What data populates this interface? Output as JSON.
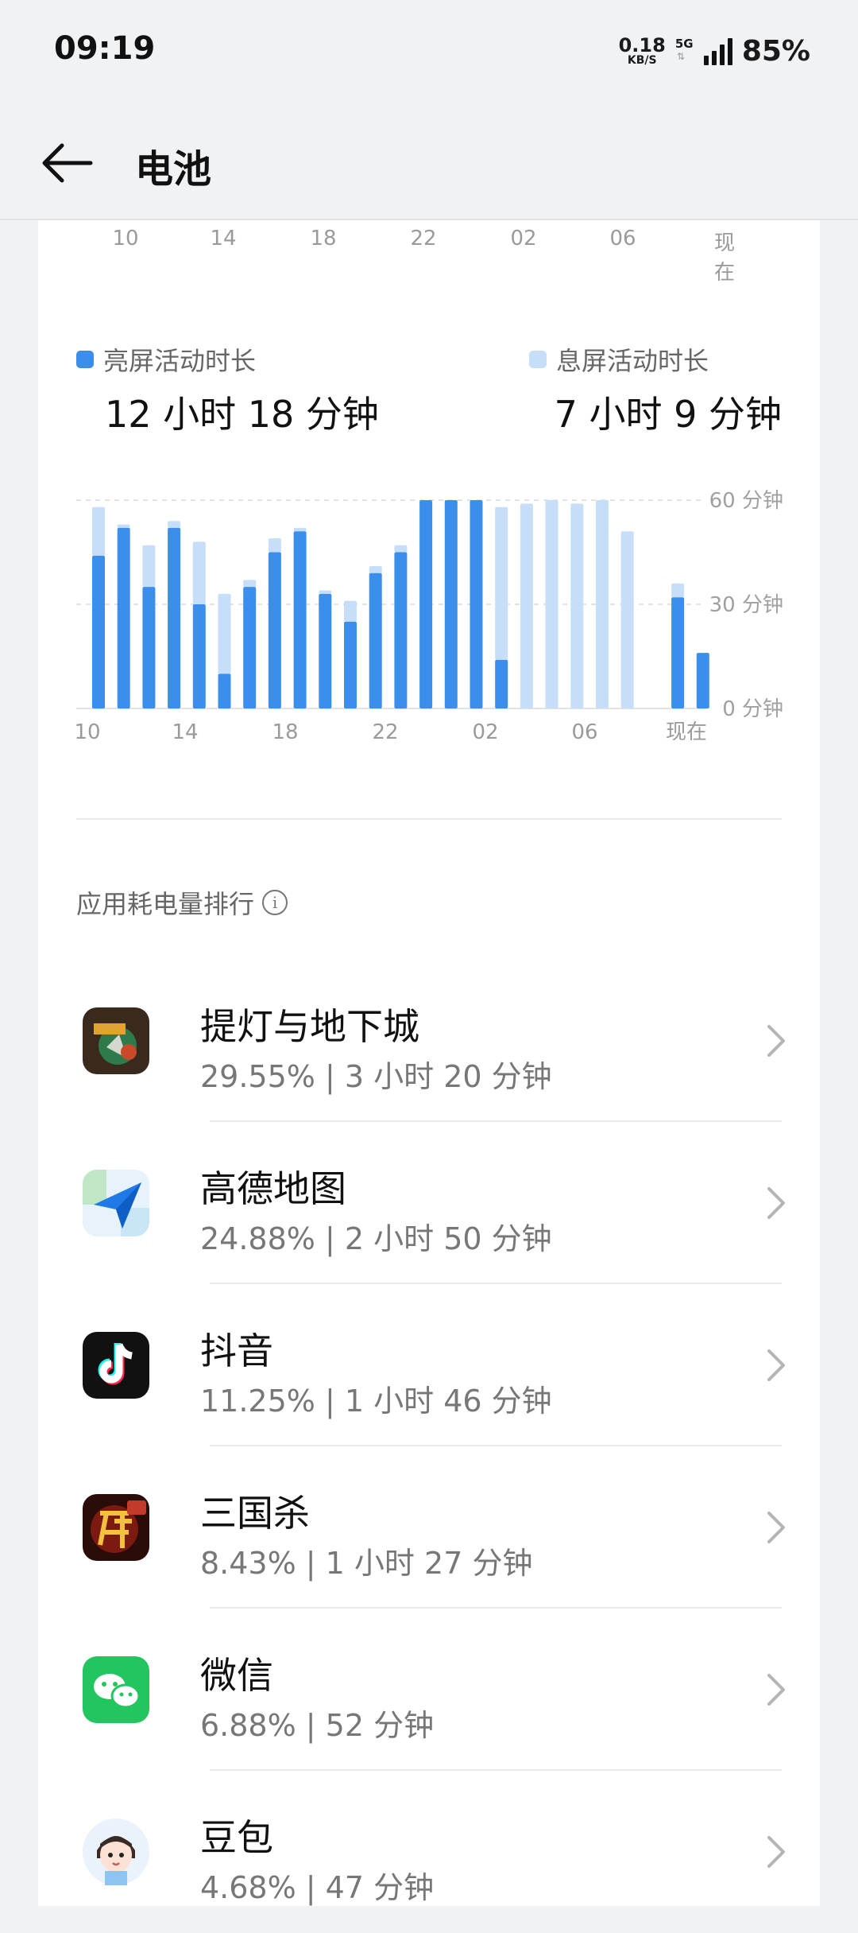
{
  "status_bar": {
    "time": "09:19",
    "net_speed_value": "0.18",
    "net_speed_unit": "KB/S",
    "network": "5G",
    "battery": "85%",
    "icons": [
      "signal-icon"
    ]
  },
  "header": {
    "title": "电池",
    "back_icon": "back-arrow-icon"
  },
  "time_axis": [
    "10",
    "14",
    "18",
    "22",
    "02",
    "06",
    "现在"
  ],
  "legend": {
    "screen_on_label": "亮屏活动时长",
    "screen_on_value": "12 小时 18 分钟",
    "screen_off_label": "息屏活动时长",
    "screen_off_value": "7 小时 9 分钟"
  },
  "colors": {
    "screen_on": "#3b8fea",
    "screen_off": "#c6def8",
    "accent": "#3b8fea"
  },
  "chart_data": {
    "type": "bar",
    "stacked": true,
    "x_tick_labels": [
      "10",
      "14",
      "18",
      "22",
      "02",
      "06",
      "现在"
    ],
    "y_tick_labels": [
      "60 分钟",
      "30 分钟",
      "0 分钟"
    ],
    "ylim": [
      0,
      60
    ],
    "grid": true,
    "series": [
      {
        "name": "亮屏活动时长",
        "values": [
          44,
          52,
          35,
          52,
          30,
          10,
          35,
          45,
          51,
          33,
          25,
          39,
          45,
          60,
          60,
          60,
          14,
          0,
          0,
          0,
          0,
          0,
          0,
          32,
          16
        ]
      },
      {
        "name": "息屏活动时长",
        "values": [
          14,
          1,
          12,
          2,
          18,
          23,
          2,
          4,
          1,
          1,
          6,
          2,
          2,
          0,
          0,
          0,
          44,
          59,
          60,
          59,
          60,
          51,
          0,
          4,
          0
        ]
      }
    ]
  },
  "ranking": {
    "title": "应用耗电量排行",
    "info_icon": "info-icon",
    "apps": [
      {
        "name": "提灯与地下城",
        "percent": "29.55%",
        "duration": "3 小时 20 分钟"
      },
      {
        "name": "高德地图",
        "percent": "24.88%",
        "duration": "2 小时 50 分钟"
      },
      {
        "name": "抖音",
        "percent": "11.25%",
        "duration": "1 小时 46 分钟"
      },
      {
        "name": "三国杀",
        "percent": "8.43%",
        "duration": "1 小时 27 分钟"
      },
      {
        "name": "微信",
        "percent": "6.88%",
        "duration": "52 分钟"
      },
      {
        "name": "豆包",
        "percent": "4.68%",
        "duration": "47 分钟"
      }
    ]
  }
}
